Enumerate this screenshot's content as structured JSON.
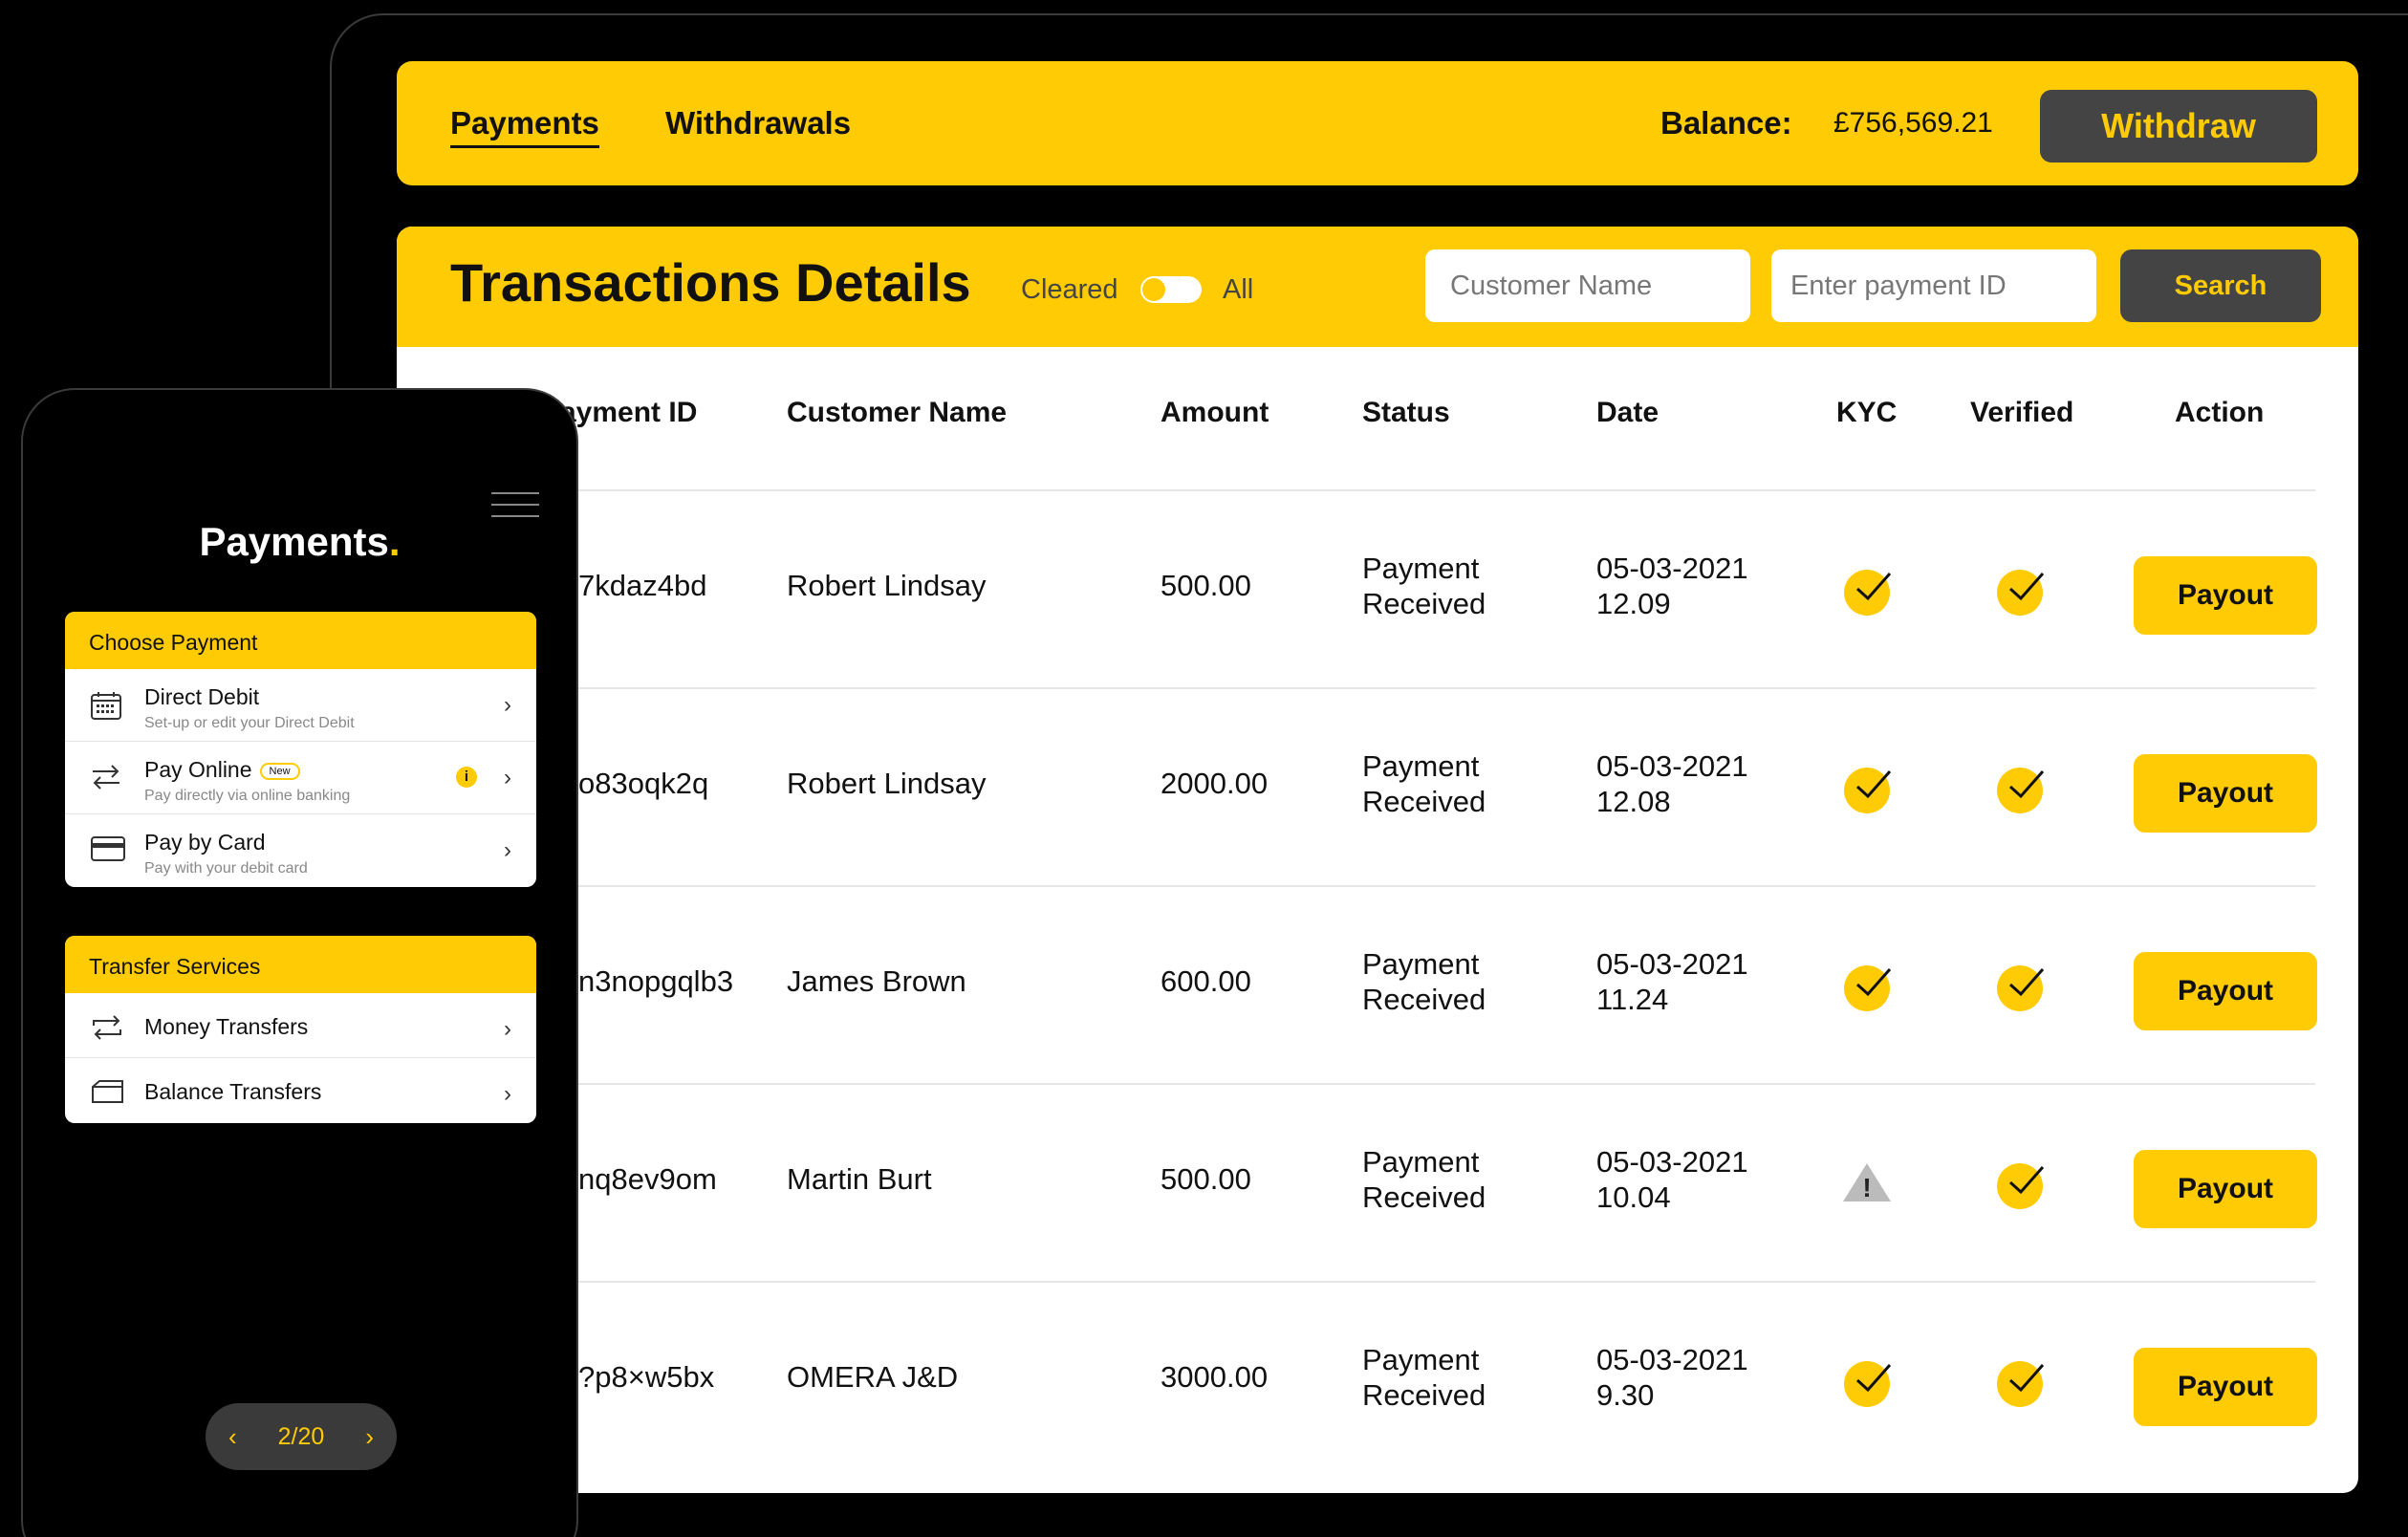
{
  "colors": {
    "accent": "#FFCB05",
    "dark": "#444444",
    "background": "#000000"
  },
  "header": {
    "tabs": [
      {
        "label": "Payments",
        "active": true
      },
      {
        "label": "Withdrawals",
        "active": false
      }
    ],
    "balance_label": "Balance:",
    "balance_value": "£756,569.21",
    "withdraw_label": "Withdraw"
  },
  "transactions": {
    "title": "Transactions Details",
    "toggle_left": "Cleared",
    "toggle_right": "All",
    "customer_placeholder": "Customer Name",
    "payment_id_placeholder": "Enter payment ID",
    "search_label": "Search",
    "columns": [
      "ayment ID",
      "Customer Name",
      "Amount",
      "Status",
      "Date",
      "KYC",
      "Verified",
      "Action"
    ],
    "rows": [
      {
        "payment_id": "7kdaz4bd",
        "customer": "Robert Lindsay",
        "amount": "500.00",
        "status_line1": "Payment",
        "status_line2": "Received",
        "date": "05-03-2021",
        "time": "12.09",
        "kyc": "check",
        "verified": "check",
        "action": "Payout"
      },
      {
        "payment_id": "o83oqk2q",
        "customer": "Robert Lindsay",
        "amount": "2000.00",
        "status_line1": "Payment",
        "status_line2": "Received",
        "date": "05-03-2021",
        "time": "12.08",
        "kyc": "check",
        "verified": "check",
        "action": "Payout"
      },
      {
        "payment_id": "n3nopgqlb3",
        "customer": "James Brown",
        "amount": "600.00",
        "status_line1": "Payment",
        "status_line2": "Received",
        "date": "05-03-2021",
        "time": "11.24",
        "kyc": "check",
        "verified": "check",
        "action": "Payout"
      },
      {
        "payment_id": "nq8ev9om",
        "customer": "Martin Burt",
        "amount": "500.00",
        "status_line1": "Payment",
        "status_line2": "Received",
        "date": "05-03-2021",
        "time": "10.04",
        "kyc": "warning",
        "verified": "check",
        "action": "Payout"
      },
      {
        "payment_id": "?p8×w5bx",
        "customer": "OMERA J&D",
        "amount": "3000.00",
        "status_line1": "Payment",
        "status_line2": "Received",
        "date": "05-03-2021",
        "time": "9.30",
        "kyc": "check",
        "verified": "check",
        "action": "Payout"
      }
    ]
  },
  "mobile": {
    "title": "Payments",
    "title_dot": ".",
    "choose_payment": {
      "heading": "Choose Payment",
      "items": [
        {
          "title": "Direct Debit",
          "subtitle": "Set-up or edit your Direct Debit",
          "icon": "calendar-icon"
        },
        {
          "title": "Pay Online",
          "badge": "New",
          "subtitle": "Pay directly via online banking",
          "icon": "transfer-arrows-icon",
          "info": "i"
        },
        {
          "title": "Pay by Card",
          "subtitle": "Pay with your debit card",
          "icon": "credit-card-icon"
        }
      ]
    },
    "transfer_services": {
      "heading": "Transfer Services",
      "items": [
        {
          "title": "Money Transfers",
          "icon": "loop-arrows-icon"
        },
        {
          "title": "Balance Transfers",
          "icon": "wallet-icon"
        }
      ]
    },
    "pager": {
      "label": "2/20",
      "prev": "‹",
      "next": "›"
    },
    "chevron": "›"
  }
}
